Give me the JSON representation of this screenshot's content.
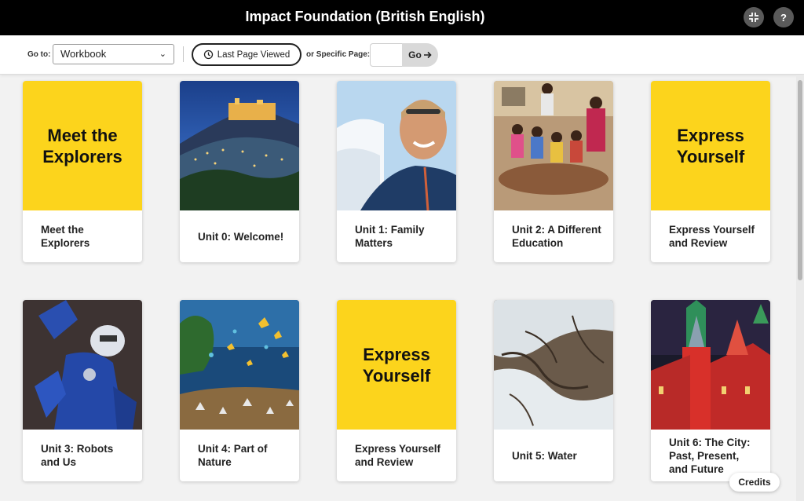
{
  "header": {
    "title": "Impact Foundation (British English)",
    "compress_icon": "compress-icon",
    "help_label": "?"
  },
  "toolbar": {
    "goto_label": "Go to:",
    "goto_selected": "Workbook",
    "last_page_label": "Last Page Viewed",
    "history_icon": "history-clock-icon",
    "specific_page_label": "or Specific Page:",
    "page_input_value": "",
    "go_label": "Go"
  },
  "cards": [
    {
      "label": "Meet the Explorers",
      "cover_text": "Meet the Explorers",
      "cover": "yellow"
    },
    {
      "label": "Unit 0: Welcome!",
      "cover": "photo-night-city"
    },
    {
      "label": "Unit 1: Family Matters",
      "cover": "photo-climber-portrait"
    },
    {
      "label": "Unit 2: A Different Education",
      "cover": "photo-classroom"
    },
    {
      "label": "Express Yourself and Review",
      "cover_text": "Express Yourself",
      "cover": "yellow"
    },
    {
      "label": "Unit 3: Robots and Us",
      "cover": "photo-robot"
    },
    {
      "label": "Unit 4: Part of Nature",
      "cover": "photo-butterflies"
    },
    {
      "label": "Express Yourself and Review",
      "cover_text": "Express Yourself",
      "cover": "yellow"
    },
    {
      "label": "Unit 5: Water",
      "cover": "photo-river-delta"
    },
    {
      "label": "Unit 6: The City: Past, Present, and Future",
      "cover": "photo-kremlin"
    }
  ],
  "credits_label": "Credits",
  "colors": {
    "accent_yellow": "#fcd41c",
    "topbar": "#000000"
  }
}
